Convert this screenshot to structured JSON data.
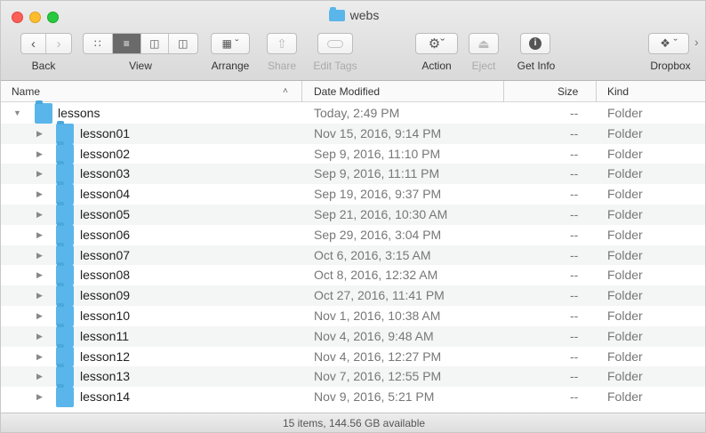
{
  "window": {
    "title": "webs"
  },
  "toolbar": {
    "back_label": "Back",
    "view_label": "View",
    "arrange_label": "Arrange",
    "share_label": "Share",
    "edit_tags_label": "Edit Tags",
    "action_label": "Action",
    "eject_label": "Eject",
    "get_info_label": "Get Info",
    "dropbox_label": "Dropbox"
  },
  "columns": {
    "name": "Name",
    "date_modified": "Date Modified",
    "size": "Size",
    "kind": "Kind"
  },
  "rows": [
    {
      "name": "lessons",
      "date": "Today, 2:49 PM",
      "size": "--",
      "kind": "Folder",
      "expanded": true
    },
    {
      "name": "lesson01",
      "date": "Nov 15, 2016, 9:14 PM",
      "size": "--",
      "kind": "Folder"
    },
    {
      "name": "lesson02",
      "date": "Sep 9, 2016, 11:10 PM",
      "size": "--",
      "kind": "Folder"
    },
    {
      "name": "lesson03",
      "date": "Sep 9, 2016, 11:11 PM",
      "size": "--",
      "kind": "Folder"
    },
    {
      "name": "lesson04",
      "date": "Sep 19, 2016, 9:37 PM",
      "size": "--",
      "kind": "Folder"
    },
    {
      "name": "lesson05",
      "date": "Sep 21, 2016, 10:30 AM",
      "size": "--",
      "kind": "Folder"
    },
    {
      "name": "lesson06",
      "date": "Sep 29, 2016, 3:04 PM",
      "size": "--",
      "kind": "Folder"
    },
    {
      "name": "lesson07",
      "date": "Oct 6, 2016, 3:15 AM",
      "size": "--",
      "kind": "Folder"
    },
    {
      "name": "lesson08",
      "date": "Oct 8, 2016, 12:32 AM",
      "size": "--",
      "kind": "Folder"
    },
    {
      "name": "lesson09",
      "date": "Oct 27, 2016, 11:41 PM",
      "size": "--",
      "kind": "Folder"
    },
    {
      "name": "lesson10",
      "date": "Nov 1, 2016, 10:38 AM",
      "size": "--",
      "kind": "Folder"
    },
    {
      "name": "lesson11",
      "date": "Nov 4, 2016, 9:48 AM",
      "size": "--",
      "kind": "Folder"
    },
    {
      "name": "lesson12",
      "date": "Nov 4, 2016, 12:27 PM",
      "size": "--",
      "kind": "Folder"
    },
    {
      "name": "lesson13",
      "date": "Nov 7, 2016, 12:55 PM",
      "size": "--",
      "kind": "Folder"
    },
    {
      "name": "lesson14",
      "date": "Nov 9, 2016, 5:21 PM",
      "size": "--",
      "kind": "Folder"
    }
  ],
  "status": {
    "text": "15 items, 144.56 GB available"
  },
  "colors": {
    "folder": "#5ab6ea",
    "close": "#fc5f57",
    "minimize": "#fdbc2e",
    "zoom": "#28c840"
  },
  "icons": [
    "close-button",
    "minimize-button",
    "zoom-button",
    "back-icon",
    "forward-icon",
    "icon-view-icon",
    "list-view-icon",
    "column-view-icon",
    "cover-flow-icon",
    "arrange-icon",
    "share-icon",
    "tag-icon",
    "gear-icon",
    "eject-icon",
    "info-icon",
    "dropbox-icon",
    "folder-icon"
  ]
}
